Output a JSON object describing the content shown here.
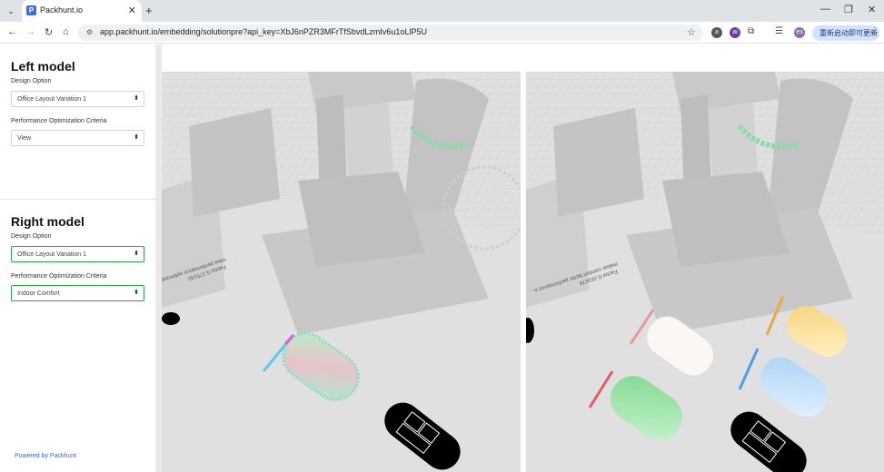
{
  "browser": {
    "tab_title": "Packhunt.io",
    "favicon_letter": "P",
    "url": "app.packhunt.io/embedding/solutionpre?api_key=XbJ6nPZR3MFrTfSbvdLzmIv6u1oLlP5U",
    "profile_pill": "重新启动即可更新",
    "ext_badges": [
      "a",
      "ai",
      "es"
    ]
  },
  "left_model": {
    "heading": "Left model",
    "design_label": "Design Option",
    "design_value": "Office Layout Variation 1",
    "criteria_label": "Performance Optimization Criteria",
    "criteria_value": "View"
  },
  "right_model": {
    "heading": "Right model",
    "design_label": "Design Option",
    "design_value": "Office Layout Variation 1",
    "criteria_label": "Performance Optimization Criteria",
    "criteria_value": "Indoor Comfort"
  },
  "footer": {
    "powered_by": "Powered by Packhunt"
  },
  "viewports": {
    "left": {
      "factor_text": "Factor:0.175102",
      "criteria_caption": "View performance optimization criteria"
    },
    "right": {
      "factor_text": "Factor:0.161678",
      "criteria_caption": "Indoor comfort factor performance o..."
    }
  },
  "colors": {
    "accent_green": "#28a745",
    "link_blue": "#2b6fd6",
    "ground": "#dedfde",
    "building": "#c7c7c7"
  }
}
